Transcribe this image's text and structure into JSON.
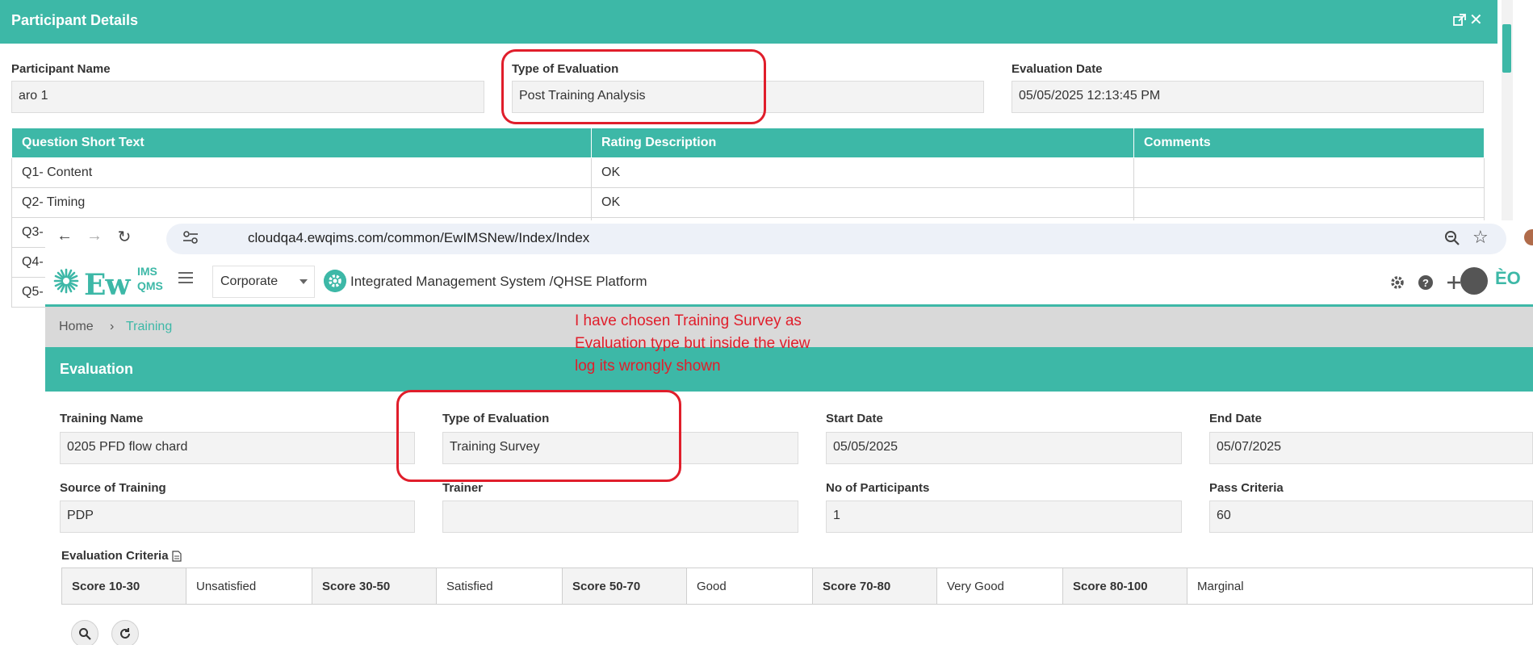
{
  "modal": {
    "title": "Participant Details",
    "fields": {
      "participant_name_label": "Participant Name",
      "participant_name_value": "aro 1",
      "type_label": "Type of Evaluation",
      "type_value": "Post Training Analysis",
      "date_label": "Evaluation Date",
      "date_value": "05/05/2025 12:13:45 PM"
    },
    "table": {
      "headers": [
        "Question Short Text",
        "Rating Description",
        "Comments"
      ],
      "rows": [
        [
          "Q1- Content",
          "OK",
          ""
        ],
        [
          "Q2- Timing",
          "OK",
          ""
        ],
        [
          "Q3-",
          "",
          ""
        ],
        [
          "Q4-",
          "",
          ""
        ],
        [
          "Q5-",
          "",
          ""
        ]
      ]
    }
  },
  "browser": {
    "url": "cloudqa4.ewqims.com/common/EwIMSNew/Index/Index"
  },
  "app": {
    "logo": {
      "main": "Ew",
      "top": "IMS",
      "bottom": "QMS"
    },
    "department": "Corporate",
    "platform_title": "Integrated Management System /QHSE Platform",
    "corner_logo": "ÈO"
  },
  "breadcrumb": {
    "home": "Home",
    "separator": "›",
    "current": "Training"
  },
  "evaluation": {
    "title": "Evaluation",
    "fields": {
      "training_name_label": "Training Name",
      "training_name_value": "0205 PFD flow chard",
      "type_label": "Type of Evaluation",
      "type_value": "Training Survey",
      "start_label": "Start Date",
      "start_value": "05/05/2025",
      "end_label": "End Date",
      "end_value": "05/07/2025",
      "source_label": "Source of Training",
      "source_value": "PDP",
      "trainer_label": "Trainer",
      "trainer_value": "",
      "participants_label": "No of Participants",
      "participants_value": "1",
      "pass_label": "Pass Criteria",
      "pass_value": "60"
    },
    "criteria_label": "Evaluation Criteria",
    "criteria": [
      {
        "score": "Score 10-30",
        "desc": "Unsatisfied"
      },
      {
        "score": "Score 30-50",
        "desc": "Satisfied"
      },
      {
        "score": "Score 50-70",
        "desc": "Good"
      },
      {
        "score": "Score 70-80",
        "desc": "Very Good"
      },
      {
        "score": "Score 80-100",
        "desc": "Marginal"
      }
    ]
  },
  "annotation": {
    "text": "I have chosen Training Survey as Evaluation type but inside the view log its wrongly shown"
  },
  "colors": {
    "accent": "#3db8a7",
    "annotation_red": "#e01e2b"
  }
}
